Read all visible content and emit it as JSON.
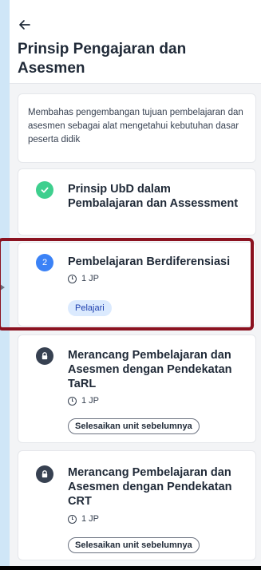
{
  "header": {
    "back_icon": "arrow-left-icon",
    "title": "Prinsip Pengajaran dan Asesmen"
  },
  "description": "Membahas pengembangan tujuan pembelajaran dan asesmen sebagai alat mengetahui kebutuhan dasar peserta didik",
  "units": [
    {
      "status": "completed",
      "status_icon": "check-circle-icon",
      "title": "Prinsip UbD dalam Pembalajaran dan Assessment"
    },
    {
      "status": "current",
      "number": "2",
      "title": "Pembelajaran Berdiferensiasi",
      "duration": "1 JP",
      "action": "Pelajari"
    },
    {
      "status": "locked",
      "status_icon": "lock-icon",
      "title": "Merancang Pembelajaran dan Asesmen dengan Pendekatan TaRL",
      "duration": "1 JP",
      "action": "Selesaikan unit sebelumnya"
    },
    {
      "status": "locked",
      "status_icon": "lock-icon",
      "title": "Merancang Pembelajaran dan Asesmen dengan Pendekatan CRT",
      "duration": "1 JP",
      "action": "Selesaikan unit sebelumnya"
    }
  ],
  "colors": {
    "completed": "#3ecf8e",
    "current": "#3b82f6",
    "locked": "#374151",
    "highlight_border": "#8b1220",
    "pill_active_bg": "#dbeafe"
  }
}
